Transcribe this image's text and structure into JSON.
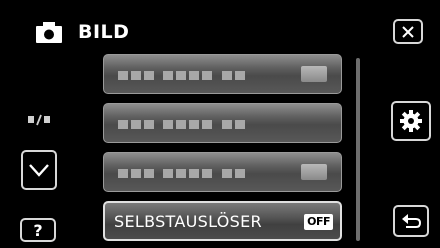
{
  "header": {
    "title": "BILD",
    "camera_icon": "camera-icon"
  },
  "buttons": {
    "close_icon": "close-icon",
    "scroll_down_icon": "chevron-down-icon",
    "help_label": "?",
    "settings_icon": "gear-icon",
    "back_icon": "return-arrow-icon"
  },
  "page_indicator": {
    "icon": "page-indicator-icon"
  },
  "menu": {
    "items": [
      {
        "label": "",
        "value": ""
      },
      {
        "label": "",
        "value": ""
      },
      {
        "label": "",
        "value": ""
      },
      {
        "label": "SELBSTAUSLÖSER",
        "value": "OFF"
      }
    ],
    "selected_index": 3
  }
}
